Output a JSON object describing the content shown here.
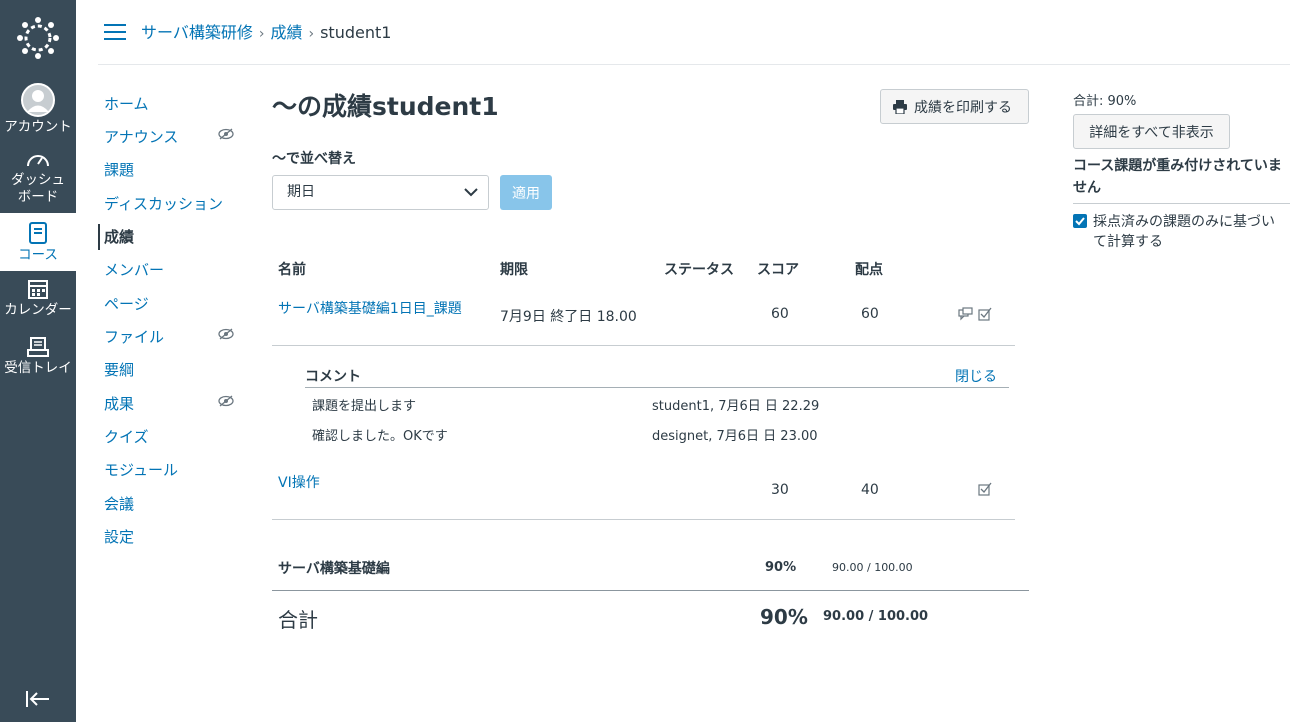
{
  "global_nav": {
    "account": "アカウント",
    "dashboard_line1": "ダッシュ",
    "dashboard_line2": "ボード",
    "courses": "コース",
    "calendar": "カレンダー",
    "inbox": "受信トレイ"
  },
  "breadcrumb": {
    "course": "サーバ構築研修",
    "section": "成績",
    "current": "student1"
  },
  "course_nav": [
    {
      "label": "ホーム",
      "hidden": false
    },
    {
      "label": "アナウンス",
      "hidden": true
    },
    {
      "label": "課題",
      "hidden": false
    },
    {
      "label": "ディスカッション",
      "hidden": false
    },
    {
      "label": "成績",
      "hidden": false,
      "active": true
    },
    {
      "label": "メンバー",
      "hidden": false
    },
    {
      "label": "ページ",
      "hidden": false
    },
    {
      "label": "ファイル",
      "hidden": true
    },
    {
      "label": "要綱",
      "hidden": false
    },
    {
      "label": "成果",
      "hidden": true
    },
    {
      "label": "クイズ",
      "hidden": false
    },
    {
      "label": "モジュール",
      "hidden": false
    },
    {
      "label": "会議",
      "hidden": false
    },
    {
      "label": "設定",
      "hidden": false
    }
  ],
  "main": {
    "title": "〜の成績student1",
    "print_button": "成績を印刷する",
    "sort_label": "〜で並べ替え",
    "sort_value": "期日",
    "apply_button": "適用"
  },
  "table": {
    "headers": {
      "name": "名前",
      "due": "期限",
      "status": "ステータス",
      "score": "スコア",
      "points": "配点"
    },
    "rows": [
      {
        "name": "サーバ構築基礎編1日目_課題",
        "due": "7月9日 終了日 18.00",
        "score": "60",
        "points": "60"
      },
      {
        "name": "VI操作",
        "due": "",
        "score": "30",
        "points": "40"
      }
    ],
    "comments": {
      "heading": "コメント",
      "close": "閉じる",
      "items": [
        {
          "text": "課題を提出します",
          "meta": "student1, 7月6日 日 22.29"
        },
        {
          "text": "確認しました。OKです",
          "meta": "designet, 7月6日 日 23.00"
        }
      ]
    },
    "group": {
      "name": "サーバ構築基礎編",
      "percent": "90%",
      "points": "90.00 / 100.00"
    },
    "total": {
      "name": "合計",
      "percent": "90%",
      "points": "90.00 / 100.00"
    }
  },
  "sidebar": {
    "total": "合計: 90%",
    "hide_button": "詳細をすべて非表示",
    "note": "コース課題が重み付けされていません",
    "checkbox_label": "採点済みの課題のみに基づいて計算する",
    "checkbox_checked": true
  }
}
